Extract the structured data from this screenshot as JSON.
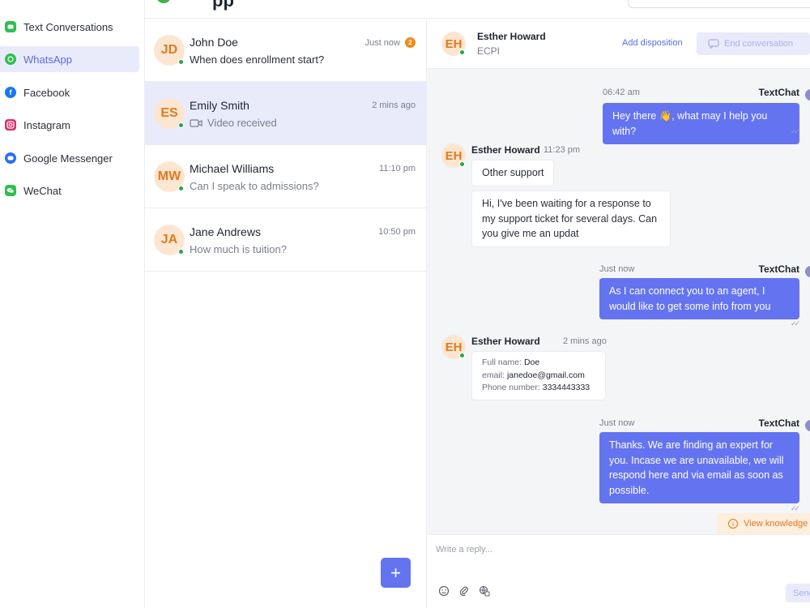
{
  "colors": {
    "accent": "#6474f0",
    "accent_light": "#e9ebfb",
    "online": "#2aa54a",
    "badge": "#f08a1c",
    "avatar_bg": "#fde6d1",
    "avatar_text": "#e07a1f"
  },
  "header": {
    "title_fragment": "pp"
  },
  "sidebar": {
    "items": [
      {
        "label": "Text Conversations",
        "icon": "text-conversations-icon",
        "color": "#2fbf4f",
        "active": false
      },
      {
        "label": "WhatsApp",
        "icon": "whatsapp-icon",
        "color": "#2fbf4f",
        "active": true
      },
      {
        "label": "Facebook",
        "icon": "facebook-icon",
        "color": "#1877f2",
        "active": false
      },
      {
        "label": "Instagram",
        "icon": "instagram-icon",
        "color": "#d6336c",
        "active": false
      },
      {
        "label": "Google Messenger",
        "icon": "google-messenger-icon",
        "color": "#2a6ff0",
        "active": false
      },
      {
        "label": "WeChat",
        "icon": "wechat-icon",
        "color": "#2fbf4f",
        "active": false
      }
    ]
  },
  "conversations": [
    {
      "initials": "JD",
      "name": "John Doe",
      "preview": "When does enrollment start?",
      "time": "Just now",
      "badge": "2"
    },
    {
      "initials": "ES",
      "name": "Emily Smith",
      "preview": "Video received",
      "time": "2 mins ago"
    },
    {
      "initials": "MW",
      "name": "Michael Williams",
      "preview": "Can I speak to admissions?",
      "time": "11:10 pm"
    },
    {
      "initials": "JA",
      "name": "Jane Andrews",
      "preview": "How much is tuition?",
      "time": "10:50 pm"
    }
  ],
  "new_conversation_label": "+",
  "chat": {
    "contact": {
      "initials": "EH",
      "name": "Esther Howard",
      "org": "ECPI"
    },
    "add_disposition": "Add disposition",
    "end_conversation": "End conversation",
    "messages": [
      {
        "time": "06:42 am",
        "sender": "TextChat",
        "text": "Hey there 👋, what may I help you with?"
      },
      {
        "sender": "Esther Howard",
        "time": "11:23 pm",
        "texts": [
          "Other support",
          "Hi, I've been waiting for a response to my support ticket for several days. Can you give me an updat"
        ]
      },
      {
        "time": "Just now",
        "sender": "TextChat",
        "text": "As I can connect you to an agent, I would like to get some info from you"
      },
      {
        "sender": "Esther Howard",
        "time": "2 mins ago",
        "details": [
          {
            "label": "Full name:",
            "value": "Doe"
          },
          {
            "label": "email:",
            "value": "janedoe@gmail.com"
          },
          {
            "label": "Phone number:",
            "value": "3334443333"
          }
        ]
      },
      {
        "time": "Just now",
        "sender": "TextChat",
        "text": "Thanks. We are finding an expert for you. Incase we are unavailable, we will respond here and via email as soon as possible."
      }
    ],
    "knowledge_label": "View knowledge",
    "reply_placeholder": "Write a reply...",
    "send_label": "Send"
  }
}
